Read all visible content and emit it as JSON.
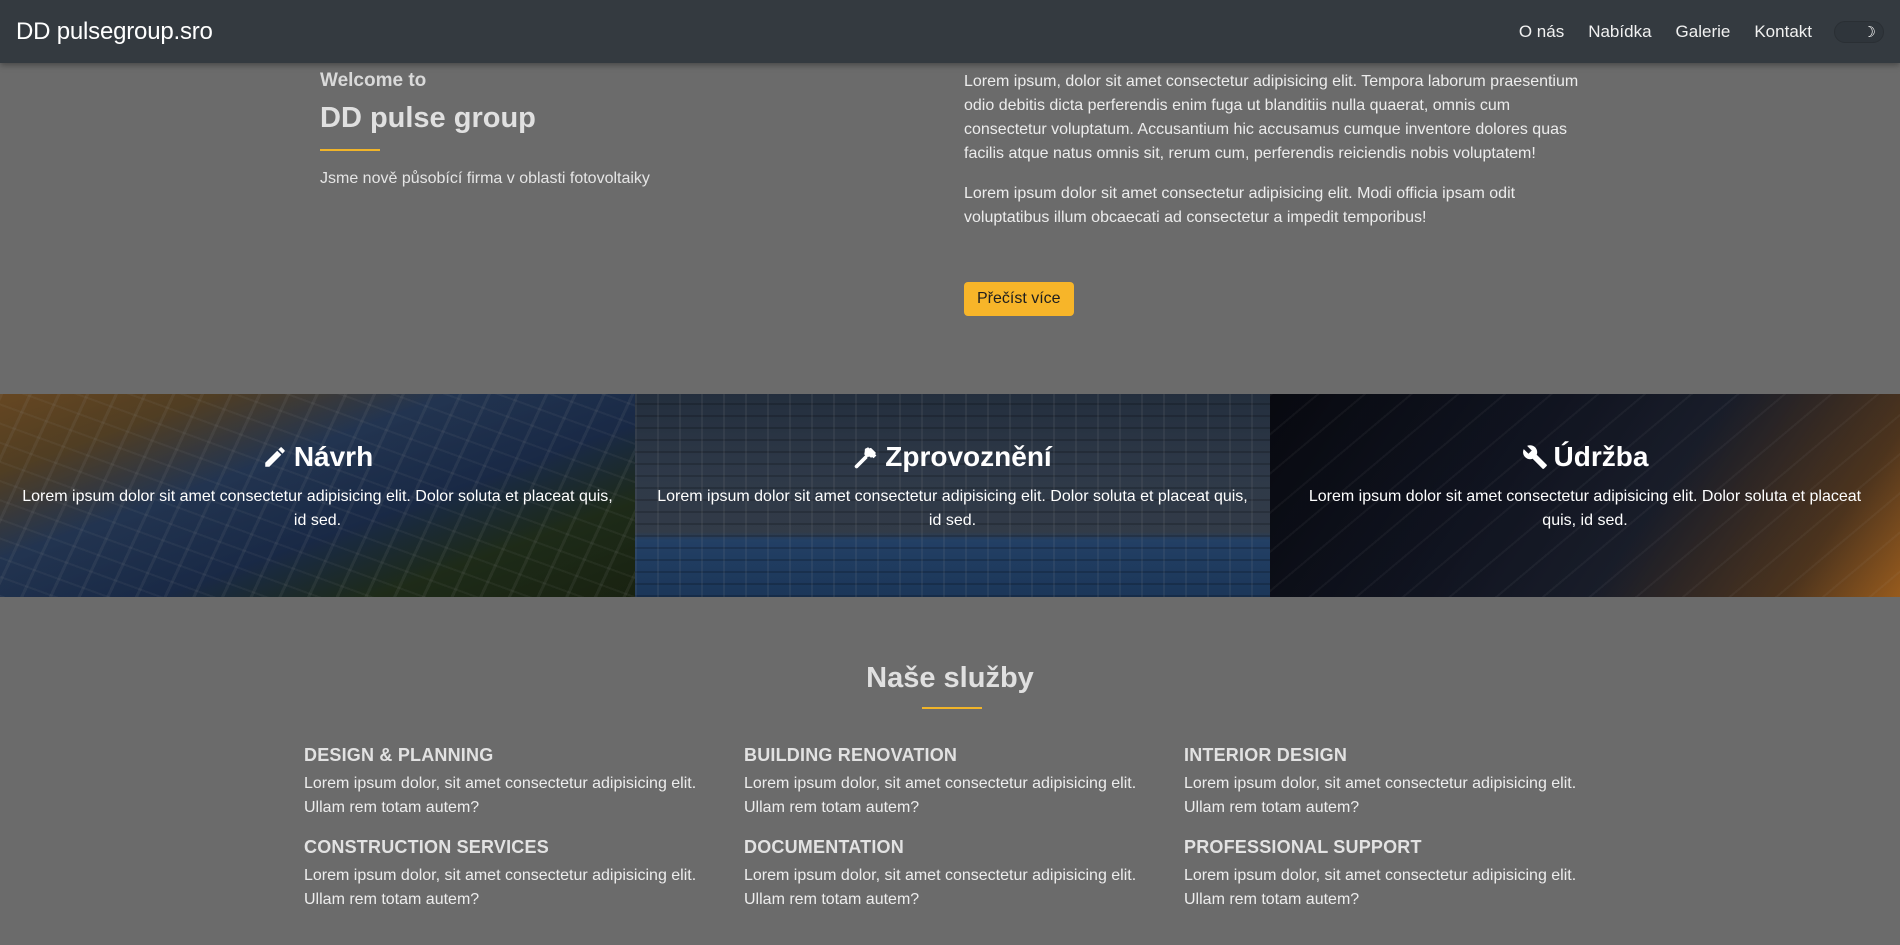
{
  "navbar": {
    "brand": "DD pulsegroup.sro",
    "links": [
      "O nás",
      "Nabídka",
      "Galerie",
      "Kontakt"
    ],
    "theme_toggle_icon": "moon-icon"
  },
  "about": {
    "welcome": "Welcome to",
    "title": "DD pulse group",
    "tagline": "Jsme nově působící firma v oblasti fotovoltaiky",
    "paragraph_1": "Lorem ipsum, dolor sit amet consectetur adipisicing elit. Tempora laborum praesentium odio debitis dicta perferendis enim fuga ut blanditiis nulla quaerat, omnis cum consectetur voluptatum. Accusantium hic accusamus cumque inventore dolores quas facilis atque natus omnis sit, rerum cum, perferendis reiciendis nobis voluptatem!",
    "paragraph_2": "Lorem ipsum dolor sit amet consectetur adipisicing elit. Modi officia ipsam odit voluptatibus illum obcaecati ad consectetur a impedit temporibus!",
    "button_label": "Přečíst více"
  },
  "features": [
    {
      "icon": "pencil-icon",
      "title": "Návrh",
      "text": "Lorem ipsum dolor sit amet consectetur adipisicing elit. Dolor soluta et placeat quis, id sed."
    },
    {
      "icon": "hammer-icon",
      "title": "Zprovoznění",
      "text": "Lorem ipsum dolor sit amet consectetur adipisicing elit. Dolor soluta et placeat quis, id sed."
    },
    {
      "icon": "wrench-icon",
      "title": "Údržba",
      "text": "Lorem ipsum dolor sit amet consectetur adipisicing elit. Dolor soluta et placeat quis, id sed."
    }
  ],
  "services": {
    "title": "Naše služby",
    "items": [
      {
        "title": "DESIGN & PLANNING",
        "text": "Lorem ipsum dolor, sit amet consectetur adipisicing elit. Ullam rem totam autem?"
      },
      {
        "title": "BUILDING RENOVATION",
        "text": "Lorem ipsum dolor, sit amet consectetur adipisicing elit. Ullam rem totam autem?"
      },
      {
        "title": "INTERIOR DESIGN",
        "text": "Lorem ipsum dolor, sit amet consectetur adipisicing elit. Ullam rem totam autem?"
      },
      {
        "title": "CONSTRUCTION SERVICES",
        "text": "Lorem ipsum dolor, sit amet consectetur adipisicing elit. Ullam rem totam autem?"
      },
      {
        "title": "DOCUMENTATION",
        "text": "Lorem ipsum dolor, sit amet consectetur adipisicing elit. Ullam rem totam autem?"
      },
      {
        "title": "PROFESSIONAL SUPPORT",
        "text": "Lorem ipsum dolor, sit amet consectetur adipisicing elit. Ullam rem totam autem?"
      }
    ]
  },
  "colors": {
    "accent": "#f7b529",
    "navbar_bg": "#343a40",
    "page_bg": "#6b6b6b"
  }
}
